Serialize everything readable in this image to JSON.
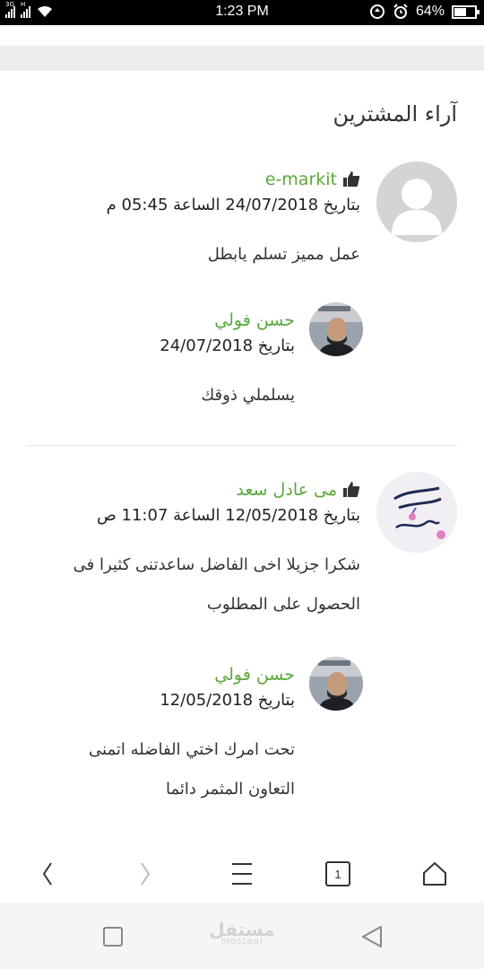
{
  "status_bar": {
    "network_label": "3G",
    "network_label_2": "H",
    "time": "1:23 PM",
    "battery": "64%",
    "battery_level": 0.64
  },
  "section_title": "آراء المشترين",
  "reviews": [
    {
      "author": "e-markit",
      "date": "بتاريخ 24/07/2018 الساعة 05:45 م",
      "comment_lines": [
        "عمل مميز تسلم يابطل"
      ],
      "reply": {
        "author": "حسن فولي",
        "date": "بتاريخ 24/07/2018",
        "comment_lines": [
          "يسلملي ذوقك"
        ]
      }
    },
    {
      "author": "مى عادل سعد",
      "date": "بتاريخ 12/05/2018 الساعة 11:07 ص",
      "comment_lines": [
        "شكرا جزيلا اخى الفاضل ساعدتنى كثيرا فى",
        "الحصول على المطلوب"
      ],
      "reply": {
        "author": "حسن فولي",
        "date": "بتاريخ 12/05/2018",
        "comment_lines": [
          "تحت امرك اختي الفاضله اتمنى",
          "التعاون المثمر دائما"
        ]
      }
    }
  ],
  "browser_toolbar": {
    "tab_count": "1"
  },
  "watermark": {
    "text": "مستقل",
    "sub": "mostaql"
  },
  "colors": {
    "author_green": "#5aa83a",
    "band_gray": "#ededed"
  }
}
